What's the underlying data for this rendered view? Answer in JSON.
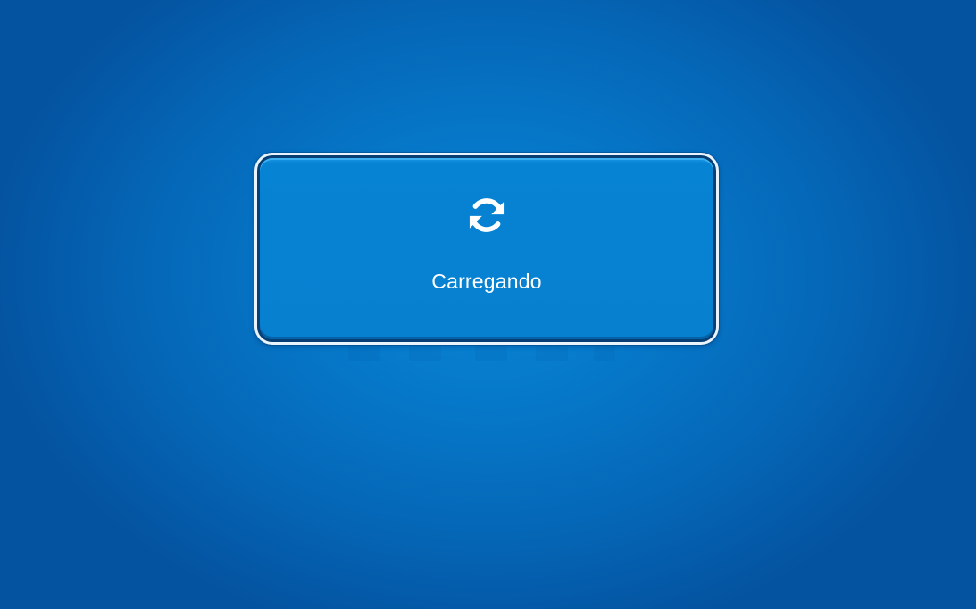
{
  "loading": {
    "icon": "refresh-icon",
    "label": "Carregando"
  },
  "colors": {
    "background": "#0678c9",
    "dialog_fill": "#0780cf",
    "dialog_border_outer": "#e9f3fb",
    "dialog_border_inner": "#073e73",
    "text": "#ffffff"
  }
}
